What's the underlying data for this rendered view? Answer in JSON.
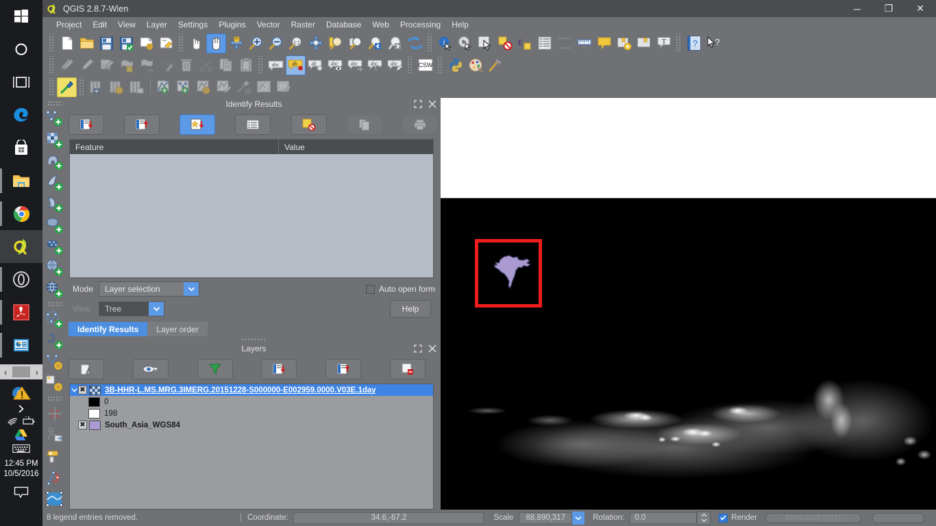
{
  "taskbar": {
    "icons": [
      {
        "name": "start-button",
        "label": "Start"
      },
      {
        "name": "cortana-search-icon",
        "label": "Search"
      },
      {
        "name": "task-view-icon",
        "label": "Task View"
      },
      {
        "name": "edge-browser-icon",
        "label": "Microsoft Edge"
      },
      {
        "name": "microsoft-store-icon",
        "label": "Store"
      },
      {
        "name": "file-explorer-icon",
        "label": "File Explorer"
      },
      {
        "name": "chrome-icon",
        "label": "Google Chrome"
      },
      {
        "name": "qgis-taskbar-icon",
        "label": "QGIS 2.8.7"
      },
      {
        "name": "opera-icon",
        "label": "Opera"
      },
      {
        "name": "adobe-reader-icon",
        "label": "Adobe Reader"
      },
      {
        "name": "powerpoint-icon",
        "label": "PowerPoint"
      }
    ],
    "tray": [
      {
        "name": "action-center-warning-icon",
        "label": "Action Center"
      },
      {
        "name": "show-hidden-icons-icon",
        "label": "Show hidden icons"
      },
      {
        "name": "wifi-icon",
        "label": "Network"
      },
      {
        "name": "battery-icon",
        "label": "Battery"
      },
      {
        "name": "google-drive-icon",
        "label": "Google Drive"
      },
      {
        "name": "touch-keyboard-icon",
        "label": "Touch keyboard"
      }
    ],
    "clock": {
      "time": "12:45 PM",
      "date": "10/5/2016"
    },
    "notifications_label": "Notifications"
  },
  "window": {
    "title": "QGIS 2.8.7-Wien",
    "minimize_label": "─",
    "maximize_label": "❐",
    "close_label": "✕"
  },
  "menubar": {
    "items": [
      {
        "label": "Project",
        "accel": "P"
      },
      {
        "label": "Edit",
        "accel": "E"
      },
      {
        "label": "View",
        "accel": "V"
      },
      {
        "label": "Layer",
        "accel": "L"
      },
      {
        "label": "Settings",
        "accel": "S"
      },
      {
        "label": "Plugins",
        "accel": "P"
      },
      {
        "label": "Vector",
        "accel": "V"
      },
      {
        "label": "Raster",
        "accel": "R"
      },
      {
        "label": "Database",
        "accel": "D"
      },
      {
        "label": "Web",
        "accel": "W"
      },
      {
        "label": "Processing",
        "accel": "c"
      },
      {
        "label": "Help",
        "accel": "H"
      }
    ]
  },
  "toolbar_row1": [
    {
      "name": "new-project-icon",
      "label": "New Project"
    },
    {
      "name": "open-project-icon",
      "label": "Open Project"
    },
    {
      "name": "save-project-icon",
      "label": "Save Project"
    },
    {
      "name": "save-project-as-icon",
      "label": "Save Project As"
    },
    {
      "name": "new-print-composer-icon",
      "label": "New Print Composer"
    },
    {
      "name": "composer-manager-icon",
      "label": "Composer Manager"
    },
    {
      "name": "touch-zoom-pan-icon",
      "label": "Touch zoom and pan"
    },
    {
      "name": "pan-map-icon",
      "label": "Pan Map",
      "active": true
    },
    {
      "name": "pan-to-selection-icon",
      "label": "Pan Map to Selection"
    },
    {
      "name": "zoom-in-icon",
      "label": "Zoom In"
    },
    {
      "name": "zoom-out-icon",
      "label": "Zoom Out"
    },
    {
      "name": "zoom-native-icon",
      "label": "Zoom to Native Resolution"
    },
    {
      "name": "zoom-full-icon",
      "label": "Zoom Full"
    },
    {
      "name": "zoom-to-selection-icon",
      "label": "Zoom to Selection"
    },
    {
      "name": "zoom-to-layer-icon",
      "label": "Zoom to Layer"
    },
    {
      "name": "zoom-last-icon",
      "label": "Zoom Last"
    },
    {
      "name": "zoom-next-icon",
      "label": "Zoom Next"
    },
    {
      "name": "refresh-icon",
      "label": "Refresh"
    },
    {
      "name": "identify-features-icon",
      "label": "Identify Features"
    },
    {
      "name": "run-feature-action-icon",
      "label": "Run Feature Action"
    },
    {
      "name": "select-features-icon",
      "label": "Select Features by area or single click"
    },
    {
      "name": "deselect-features-icon",
      "label": "Deselect Features from All Layers"
    },
    {
      "name": "select-by-expression-icon",
      "label": "Select features using an expression"
    },
    {
      "name": "open-attribute-table-icon",
      "label": "Open Attribute Table"
    },
    {
      "name": "statistical-summary-icon",
      "label": "Show Statistical Summary"
    },
    {
      "name": "measure-line-icon",
      "label": "Measure Line"
    },
    {
      "name": "map-tips-icon",
      "label": "Show Map Tips"
    },
    {
      "name": "new-bookmark-icon",
      "label": "New Bookmark"
    },
    {
      "name": "show-bookmarks-icon",
      "label": "Show Bookmarks"
    },
    {
      "name": "text-annotation-icon",
      "label": "Text Annotation"
    },
    {
      "name": "help-contents-icon",
      "label": "Help Contents"
    },
    {
      "name": "whats-this-icon",
      "label": "What's This?"
    }
  ],
  "toolbar_row2": [
    {
      "name": "current-edits-icon",
      "label": "Current Edits"
    },
    {
      "name": "toggle-editing-icon",
      "label": "Toggle Editing"
    },
    {
      "name": "save-layer-edits-icon",
      "label": "Save Layer Edits"
    },
    {
      "name": "add-feature-icon",
      "label": "Add Feature"
    },
    {
      "name": "move-feature-icon",
      "label": "Move Feature"
    },
    {
      "name": "node-tool-icon",
      "label": "Node Tool"
    },
    {
      "name": "delete-selected-icon",
      "label": "Delete Selected"
    },
    {
      "name": "cut-features-icon",
      "label": "Cut Features"
    },
    {
      "name": "copy-features-icon",
      "label": "Copy Features"
    },
    {
      "name": "paste-features-icon",
      "label": "Paste Features"
    },
    {
      "name": "label-icon",
      "label": "Layer Labeling Options"
    },
    {
      "name": "highlight-pinned-labels-icon",
      "label": "Highlight Pinned Labels",
      "active": true
    },
    {
      "name": "pin-labels-icon",
      "label": "Pin/Unpin Labels"
    },
    {
      "name": "show-hide-labels-icon",
      "label": "Show/Hide Labels"
    },
    {
      "name": "move-label-icon",
      "label": "Move Label"
    },
    {
      "name": "rotate-label-icon",
      "label": "Rotate Label"
    },
    {
      "name": "change-label-icon",
      "label": "Change Label"
    },
    {
      "name": "metasearch-csw-icon",
      "label": "MetaSearch"
    },
    {
      "name": "python-console-icon",
      "label": "Python Console"
    },
    {
      "name": "plugin-manager-icon",
      "label": "Manage and Install Plugins"
    },
    {
      "name": "plugin-builder-icon",
      "label": "Plugin Builder"
    }
  ],
  "toolbar_row3": [
    {
      "name": "glue-plugin-icon",
      "label": "Plugin",
      "active": true
    },
    {
      "name": "raster-calculator-icon",
      "label": "Raster Calculator"
    },
    {
      "name": "raster-align-icon",
      "label": "Align Raster"
    },
    {
      "name": "raster-histogram-icon",
      "label": "Raster Histogram"
    },
    {
      "name": "new-shapefile-layer-icon",
      "label": "New Shapefile Layer"
    },
    {
      "name": "new-spatialite-layer-icon",
      "label": "New SpatiaLite Layer"
    },
    {
      "name": "new-memory-layer-icon",
      "label": "New Temporary Scratch Layer"
    },
    {
      "name": "new-gpx-layer-icon",
      "label": "New GPX Layer"
    },
    {
      "name": "merge-tools-icon",
      "label": "Merge Tools"
    },
    {
      "name": "new-composer-template-icon",
      "label": "Composer Template"
    },
    {
      "name": "edit-composer-template-icon",
      "label": "Edit Composer Template"
    }
  ],
  "left_toolbar": [
    {
      "name": "add-vector-layer-icon",
      "label": "Add Vector Layer"
    },
    {
      "name": "add-raster-layer-icon",
      "label": "Add Raster Layer"
    },
    {
      "name": "add-postgis-layer-icon",
      "label": "Add PostGIS Layer"
    },
    {
      "name": "add-spatialite-layer-icon",
      "label": "Add SpatiaLite Layer"
    },
    {
      "name": "add-mssql-layer-icon",
      "label": "Add MSSQL Spatial Layer"
    },
    {
      "name": "add-oracle-layer-icon",
      "label": "Add Oracle Spatial Layer"
    },
    {
      "name": "add-wms-layer-icon",
      "label": "Add WMS/WMTS Layer"
    },
    {
      "name": "add-wcs-layer-icon",
      "label": "Add WCS Layer"
    },
    {
      "name": "add-wfs-layer-icon",
      "label": "Add WFS Layer"
    },
    {
      "name": "add-delimited-text-layer-icon",
      "label": "Add Delimited Text Layer"
    },
    {
      "name": "new-vector-layer-icon",
      "label": "New Vector Layer"
    },
    {
      "name": "new-memory-layer-icon",
      "label": "New Memory Layer"
    },
    {
      "name": "georeferencer-icon",
      "label": "Georeferencer"
    },
    {
      "name": "offline-editing-icon",
      "label": "Offline Editing"
    },
    {
      "name": "gps-tools-icon",
      "label": "GPS Tools"
    },
    {
      "name": "road-graph-icon",
      "label": "Road Graph"
    },
    {
      "name": "interpolation-icon",
      "label": "Interpolation"
    }
  ],
  "identify_panel": {
    "title": "Identify Results",
    "float_label": "Float",
    "close_label": "Close",
    "toolbar": [
      {
        "name": "expand-new-results-icon",
        "label": "Expand New Results by Default"
      },
      {
        "name": "collapse-all-icon",
        "label": "Collapse All"
      },
      {
        "name": "expand-all-icon",
        "label": "Expand All",
        "selected": true
      },
      {
        "name": "show-attribute-form-icon",
        "label": "Open Form"
      },
      {
        "name": "clear-results-icon",
        "label": "Clear Results"
      },
      {
        "name": "copy-icon",
        "label": "Copy",
        "disabled": true
      },
      {
        "name": "print-icon",
        "label": "Print",
        "disabled": true
      }
    ],
    "table": {
      "columns": [
        "Feature",
        "Value"
      ],
      "rows": []
    },
    "mode_label": "Mode",
    "mode_value": "Layer selection",
    "view_label": "View",
    "view_value": "Tree",
    "auto_open_form_label": "Auto open form",
    "auto_open_form_checked": false,
    "help_label": "Help",
    "tabs": [
      {
        "label": "Identify Results",
        "active": true
      },
      {
        "label": "Layer order",
        "active": false
      }
    ]
  },
  "layers_panel": {
    "title": "Layers",
    "float_label": "Float",
    "close_label": "Close",
    "toolbar": [
      {
        "name": "layer-styling-icon",
        "label": "Open Layer Styling Panel"
      },
      {
        "name": "manage-visibility-icon",
        "label": "Manage Layer Visibility"
      },
      {
        "name": "filter-legend-icon",
        "label": "Filter Legend By Map Content"
      },
      {
        "name": "expand-all-layers-icon",
        "label": "Expand All"
      },
      {
        "name": "collapse-all-layers-icon",
        "label": "Collapse All"
      },
      {
        "name": "remove-layer-icon",
        "label": "Remove Layer/Group"
      }
    ],
    "tree": [
      {
        "name": "3B-HHR-L.MS.MRG.3IMERG.20151228-S000000-E002959.0000.V03E.1day",
        "type": "raster",
        "checked": true,
        "selected": true,
        "expanded": true,
        "classes": [
          {
            "label": "0",
            "color": "#000000"
          },
          {
            "label": "198",
            "color": "#ffffff"
          }
        ]
      },
      {
        "name": "South_Asia_WGS84",
        "type": "vector",
        "checked": true,
        "selected": false,
        "color": "#aa9ad1"
      }
    ]
  },
  "map": {
    "selection_rect_label": "Identify selection rectangle",
    "selection_color": "#ee1c1c",
    "polygon_label": "South Asia polygon",
    "polygon_fill": "#aa9ad1",
    "polygon_stroke": "#3a3a5a",
    "raster_label": "IMERG precipitation raster"
  },
  "statusbar": {
    "message": "8 legend entries removed.",
    "coordinate_label": "Coordinate:",
    "coordinate_value": "34.6,-67.2",
    "scale_label": "Scale",
    "scale_value": "88,890,317",
    "rotation_label": "Rotation:",
    "rotation_value": "0.0",
    "render_label": "Render",
    "render_checked": true,
    "crs_value": "EPSG:4326 (OTF)"
  }
}
